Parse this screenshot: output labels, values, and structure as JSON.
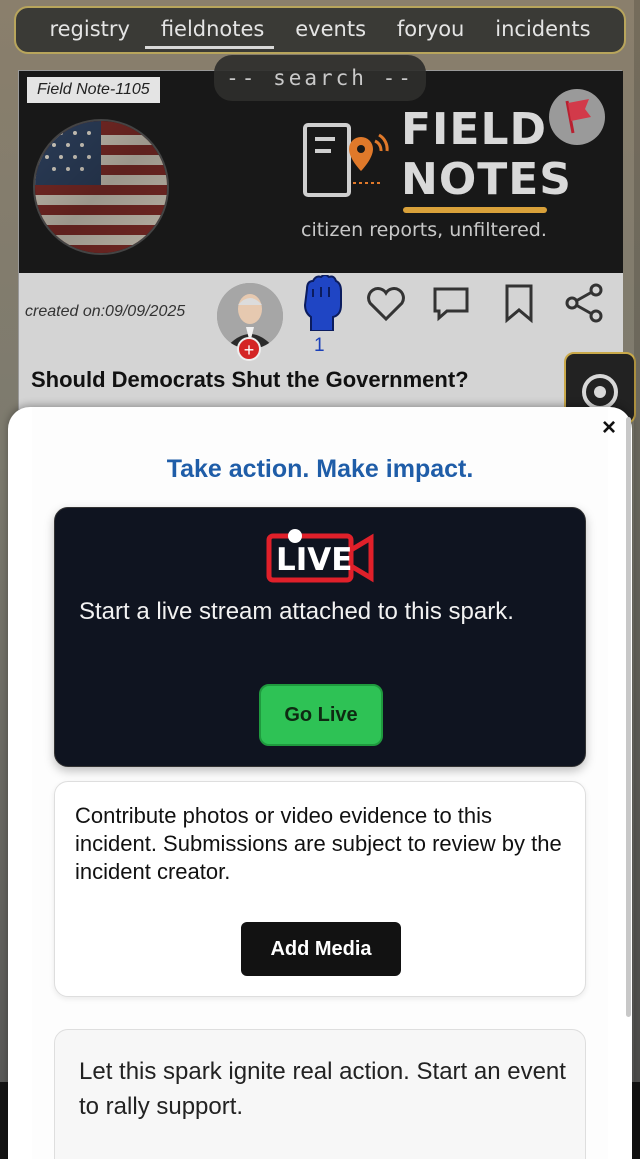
{
  "nav": {
    "tabs": [
      {
        "label": "registry"
      },
      {
        "label": "fieldnotes"
      },
      {
        "label": "events"
      },
      {
        "label": "foryou"
      },
      {
        "label": "incidents"
      }
    ],
    "active": "fieldnotes"
  },
  "search": {
    "label": "-- search --"
  },
  "card": {
    "tag": "Field Note-1105",
    "brand_line1": "FIELD",
    "brand_line2": "NOTES",
    "brand_sub": "citizen reports, unfiltered.",
    "created": "created on:09/09/2025",
    "fist_count": "1",
    "title": "Should Democrats Shut the Government?"
  },
  "modal": {
    "close_glyph": "×",
    "heading": "Take action. Make impact.",
    "live": {
      "badge": "LIVE",
      "text": "Start a live stream attached to this spark.",
      "button": "Go Live"
    },
    "media": {
      "text": "Contribute photos or video evidence to this incident. Submissions are subject to review by the incident creator.",
      "button": "Add Media"
    },
    "event": {
      "text": "Let this spark ignite real action. Start an event to rally support."
    }
  },
  "colors": {
    "heading_blue": "#1f5da8",
    "go_live_green": "#2ec255",
    "live_red": "#e0202a",
    "nav_border": "#b8a55c",
    "brand_accent": "#d9a13a"
  },
  "icons": [
    "report-flag-icon",
    "raised-fist-icon",
    "heart-icon",
    "comment-icon",
    "bookmark-icon",
    "share-icon",
    "target-icon",
    "close-icon",
    "live-camera-icon",
    "notebook-pin-icon"
  ]
}
